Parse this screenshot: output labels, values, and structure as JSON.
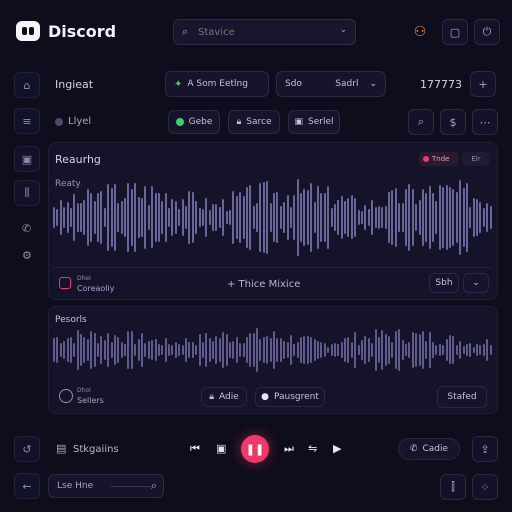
{
  "app": {
    "title": "Discord"
  },
  "search": {
    "placeholder": "Stavice"
  },
  "toolbar": {
    "title": "Ingieat",
    "mode_button": "A Som Eetlng",
    "select_left": "Sdo",
    "select_right": "Sadrl",
    "counter": "177773",
    "add_label": "+"
  },
  "filter_row": {
    "layer_label": "Llyel",
    "chip_one": "Gebe",
    "chip_two": "Sarce",
    "chip_three": "Serlel"
  },
  "panel_one": {
    "title": "Reaurhg",
    "badge_red": "Tnde",
    "badge_plain": "Elr",
    "sub_title": "Reaty",
    "item_title": "Dhel",
    "item_sub": "Coreaoliy",
    "center_action": "+ Thice Mixice",
    "right_button": "Sbh"
  },
  "panel_two": {
    "title": "Pesorls",
    "item_title": "Dhol",
    "item_sub": "Sellers",
    "action_one": "Adie",
    "action_two": "Pausgrent",
    "right_button": "Stafed"
  },
  "player": {
    "left_label": "Stkgaiins",
    "right_label": "Cadie"
  },
  "footer": {
    "input_value": "Lse Hne"
  },
  "colors": {
    "accent_red": "#f0396a",
    "green": "#3ecf6a",
    "orange": "#e88c4c",
    "background": "#0e0d1c"
  }
}
